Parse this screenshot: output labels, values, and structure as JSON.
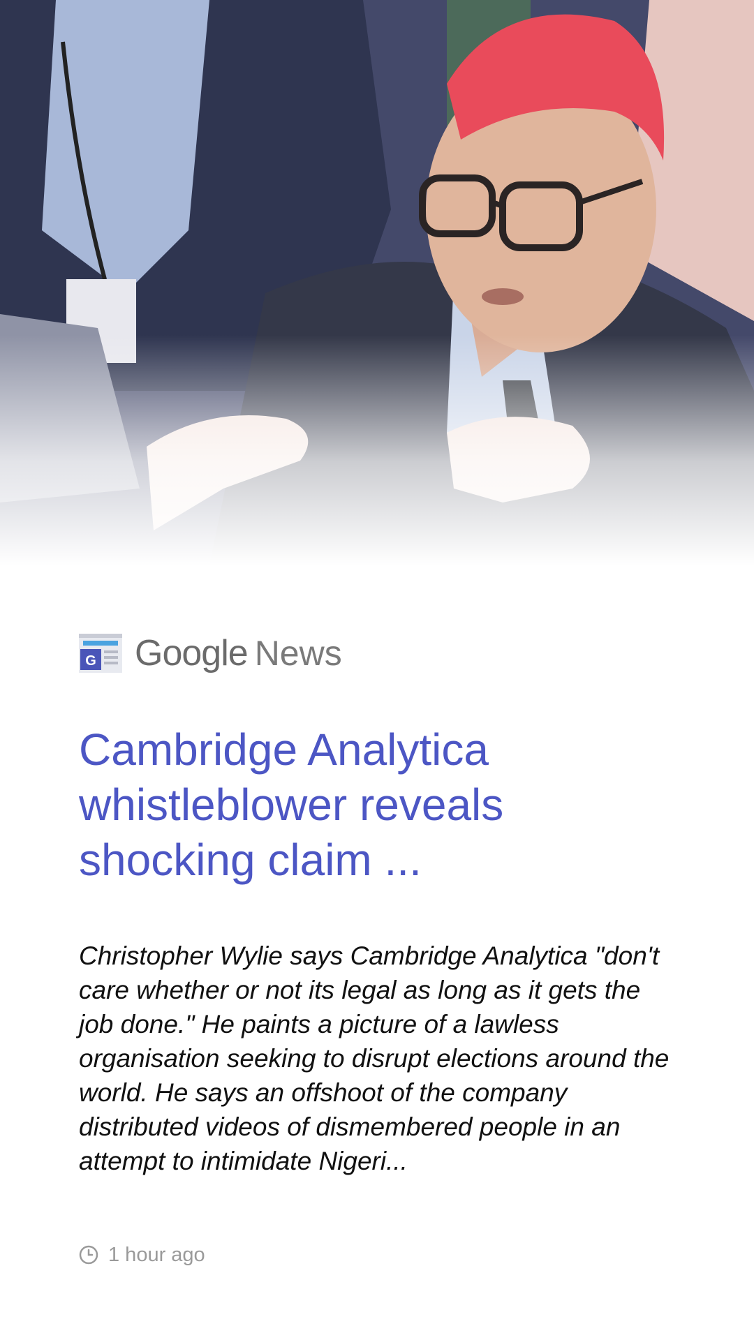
{
  "card": {
    "hero": {
      "icon": "news-photo"
    },
    "brand": {
      "logo_icon": "google-news-logo-icon",
      "google": "Google",
      "news": "News"
    },
    "headline": "Cambridge Analytica whistleblower reveals shocking claim ...",
    "summary": "Christopher Wylie says Cambridge Analytica \"don't care whether or not its legal as long as it gets the job done.\" He paints a picture of a lawless organisation seeking to disrupt elections around the world. He says an offshoot of the company distributed videos of dismembered people in an attempt to intimidate Nigeri...",
    "timestamp": {
      "icon": "clock-icon",
      "text": "1 hour ago"
    }
  },
  "colors": {
    "headline": "#4c56c4",
    "brand_text": "#6b6b6b",
    "timestamp_text": "#9a9a9a",
    "summary_text": "#111111"
  }
}
